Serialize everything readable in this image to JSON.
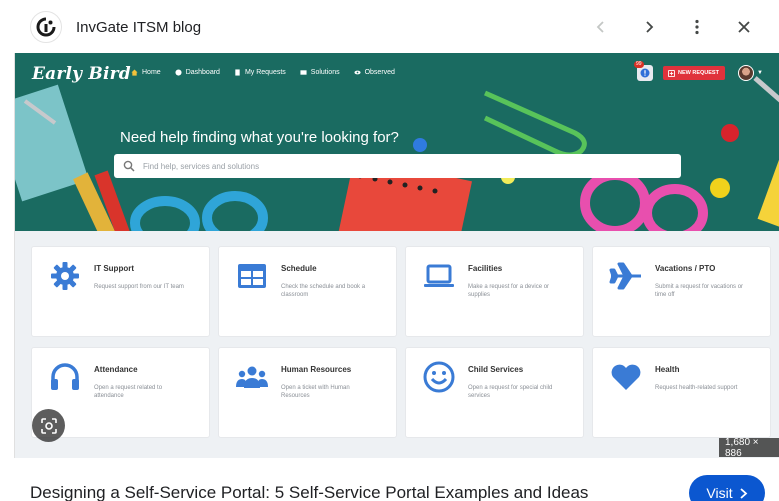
{
  "viewer": {
    "site_name": "InvGate ITSM blog",
    "dimensions": "1,680 × 886",
    "article_title": "Designing a Self-Service Portal: 5 Self-Service Portal Examples and Ideas",
    "visit_label": "Visit"
  },
  "portal": {
    "logo_text": "Early Bird",
    "nav": [
      {
        "label": "Home",
        "icon": "home-icon"
      },
      {
        "label": "Dashboard",
        "icon": "dashboard-icon"
      },
      {
        "label": "My Requests",
        "icon": "requests-icon"
      },
      {
        "label": "Solutions",
        "icon": "solutions-icon"
      },
      {
        "label": "Observed",
        "icon": "eye-icon"
      }
    ],
    "notification_count": "99",
    "new_request_label": "NEW REQUEST",
    "hero_title": "Need help finding what you're looking for?",
    "search_placeholder": "Find help, services and solutions",
    "services": [
      {
        "title": "IT Support",
        "desc": "Request support from our IT team",
        "icon": "gear-icon"
      },
      {
        "title": "Schedule",
        "desc": "Check the schedule and book a classroom",
        "icon": "calendar-grid-icon"
      },
      {
        "title": "Facilities",
        "desc": "Make a request for a device or supplies",
        "icon": "laptop-icon"
      },
      {
        "title": "Vacations / PTO",
        "desc": "Submit a request for vacations or time off",
        "icon": "airplane-icon"
      },
      {
        "title": "Attendance",
        "desc": "Open a request related to attendance",
        "icon": "headphones-icon"
      },
      {
        "title": "Human Resources",
        "desc": "Open a ticket with Human Resources",
        "icon": "people-icon"
      },
      {
        "title": "Child Services",
        "desc": "Open a request for special child services",
        "icon": "smiley-icon"
      },
      {
        "title": "Health",
        "desc": "Request health-related support",
        "icon": "heart-icon"
      }
    ]
  },
  "colors": {
    "accent_blue": "#3a7bd5",
    "hero_green": "#1b6e63",
    "new_request_red": "#e0323c",
    "visit_blue": "#0b57d0"
  }
}
